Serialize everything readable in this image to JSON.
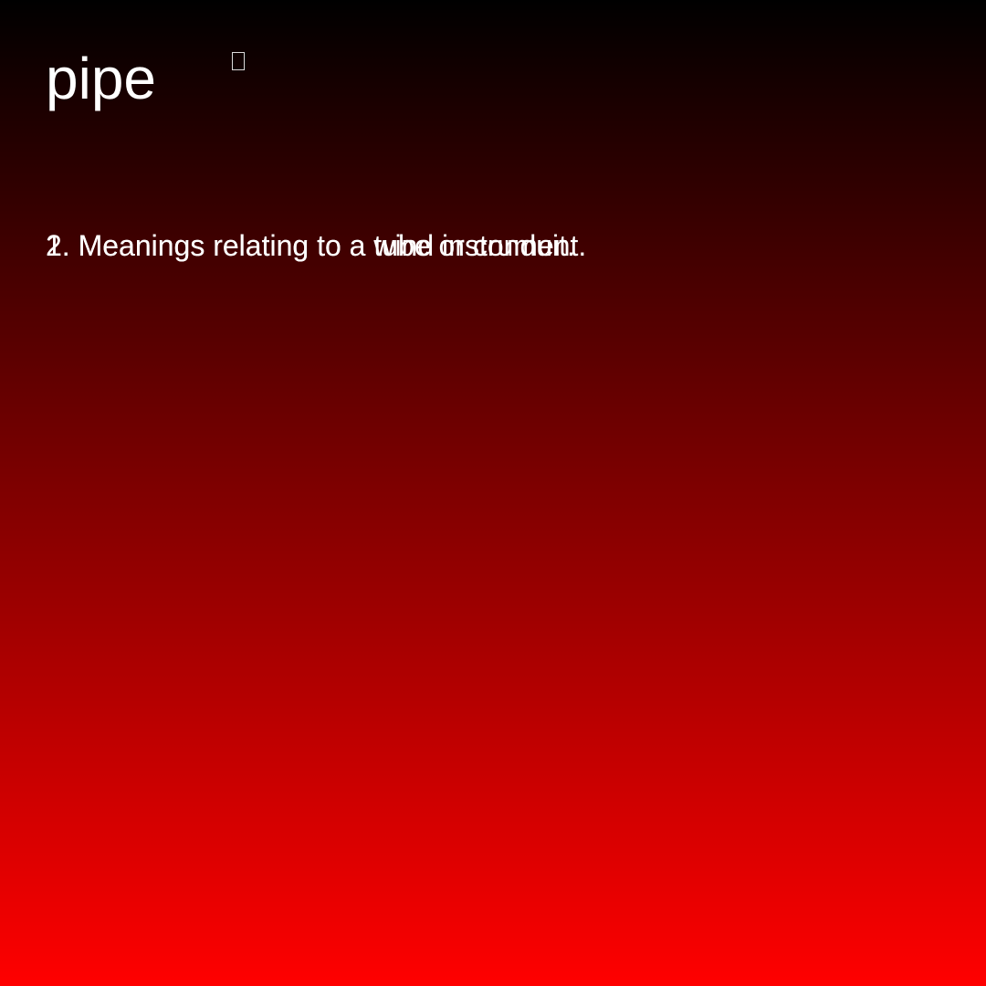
{
  "word": "pipe",
  "icon": "missing-glyph-icon",
  "meanings": [
    "1. Meanings relating to a tube or conduit.",
    "2. Meanings relating to a wind instrument."
  ],
  "colors": {
    "background_top": "#000000",
    "background_bottom": "#ff0000",
    "text": "#ffffff"
  }
}
